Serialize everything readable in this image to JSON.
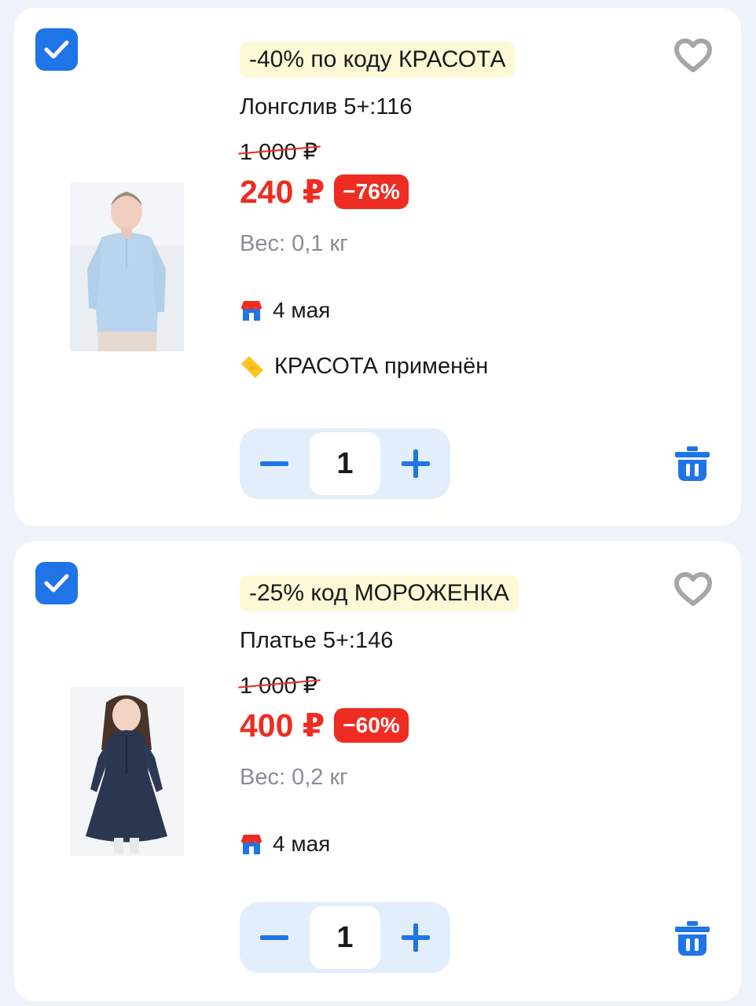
{
  "colors": {
    "accent": "#1f74e8",
    "price_red": "#ee2c22",
    "promo_bg": "#fdf9d6",
    "stepper_bg": "#e2eefc",
    "muted_text": "#8b8d94"
  },
  "items": [
    {
      "selected": true,
      "promo": "-40% по коду КРАСОТА",
      "name": "Лонгслив 5+:116",
      "old_price": "1 000 ₽",
      "price": "240 ₽",
      "discount": "−76%",
      "weight": "Вес: 0,1 кг",
      "delivery_icon": "store-icon",
      "delivery": "4 мая",
      "coupon_icon": "coupon-icon",
      "coupon": "КРАСОТА применён",
      "quantity": "1",
      "image_alt": "girl in light-blue longsleeve"
    },
    {
      "selected": true,
      "promo": "-25% код МОРОЖЕНКА",
      "name": "Платье 5+:146",
      "old_price": "1 000 ₽",
      "price": "400 ₽",
      "discount": "−60%",
      "weight": "Вес: 0,2 кг",
      "delivery_icon": "store-icon",
      "delivery": "4 мая",
      "quantity": "1",
      "image_alt": "girl in navy dress"
    }
  ]
}
